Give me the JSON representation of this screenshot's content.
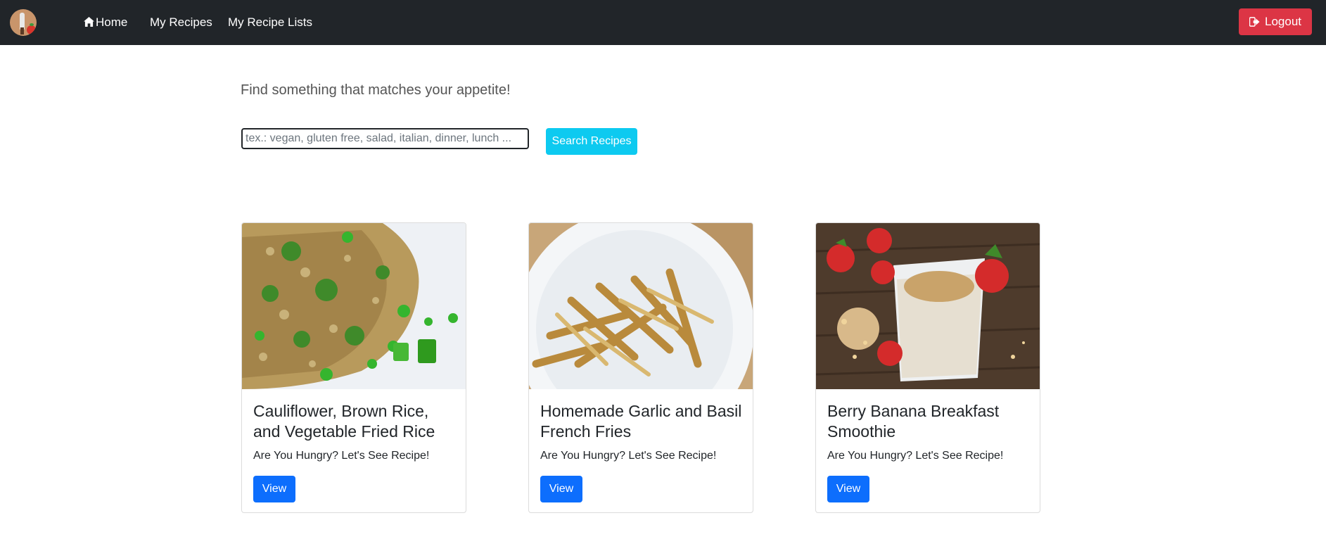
{
  "nav": {
    "home_label": "Home",
    "my_recipes_label": "My Recipes",
    "my_recipe_lists_label": "My Recipe Lists",
    "logout_label": "Logout"
  },
  "search": {
    "tagline": "Find something that matches your appetite!",
    "placeholder": "tex.: vegan, gluten free, salad, italian, dinner, lunch ...",
    "button_label": "Search Recipes"
  },
  "recipes": [
    {
      "title": "Cauliflower, Brown Rice, and Vegetable Fried Rice",
      "text": "Are You Hungry? Let's See Recipe!",
      "button_label": "View"
    },
    {
      "title": "Homemade Garlic and Basil French Fries",
      "text": "Are You Hungry? Let's See Recipe!",
      "button_label": "View"
    },
    {
      "title": "Berry Banana Breakfast Smoothie",
      "text": "Are You Hungry? Let's See Recipe!",
      "button_label": "View"
    }
  ],
  "colors": {
    "navbar": "#212529",
    "logout": "#dc3545",
    "search_button": "#0dcaf0",
    "view_button": "#0d6efd"
  }
}
